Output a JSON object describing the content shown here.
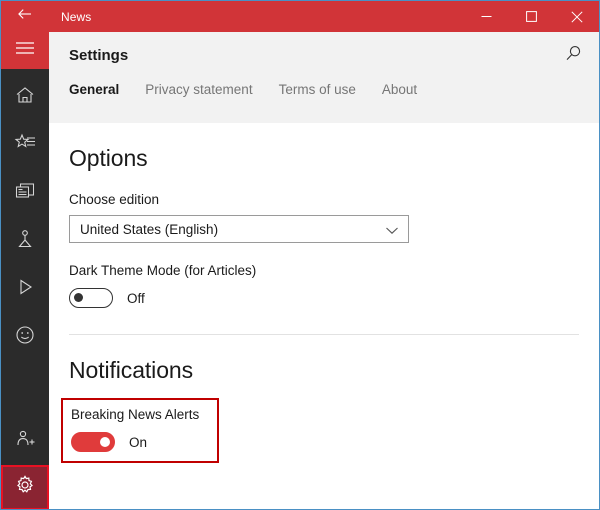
{
  "window": {
    "title": "News",
    "back_icon": "back-arrow-icon",
    "controls": {
      "minimize": "minimize-icon",
      "maximize": "maximize-icon",
      "close": "close-icon"
    },
    "accent_color": "#d13438",
    "border_color": "#4a90c4"
  },
  "sidebar": {
    "hamburger": {
      "icon": "hamburger-menu-icon",
      "label": "Menu"
    },
    "items": [
      {
        "icon": "home-icon",
        "label": "Home"
      },
      {
        "icon": "star-list-icon",
        "label": "My News"
      },
      {
        "icon": "newspaper-icon",
        "label": "Local"
      },
      {
        "icon": "person-stand-icon",
        "label": "Sports"
      },
      {
        "icon": "play-triangle-icon",
        "label": "Video"
      },
      {
        "icon": "smiley-face-icon",
        "label": "Lifestyle"
      }
    ],
    "bottom_items": [
      {
        "icon": "person-add-icon",
        "label": "Sign in"
      },
      {
        "icon": "gear-icon",
        "label": "Settings",
        "selected": true,
        "selected_bg": "#8a2432"
      }
    ]
  },
  "header": {
    "title": "Settings",
    "search_icon": "search-icon"
  },
  "tabs": [
    {
      "label": "General",
      "active": true
    },
    {
      "label": "Privacy statement",
      "active": false
    },
    {
      "label": "Terms of use",
      "active": false
    },
    {
      "label": "About",
      "active": false
    }
  ],
  "options": {
    "heading": "Options",
    "edition_label": "Choose edition",
    "edition_value": "United States (English)",
    "edition_chevron": "chevron-down-icon",
    "dark_theme_label": "Dark Theme Mode (for Articles)",
    "dark_theme_state": "Off"
  },
  "notifications": {
    "heading": "Notifications",
    "breaking_news_label": "Breaking News Alerts",
    "breaking_news_state": "On",
    "highlight_color": "#c00000",
    "toggle_on_color": "#e03b3b"
  }
}
